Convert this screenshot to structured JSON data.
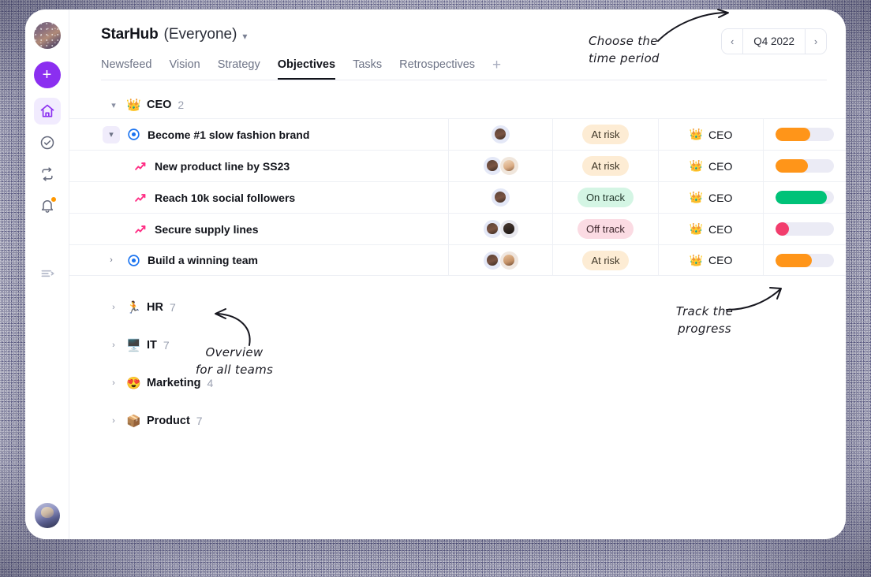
{
  "window": {
    "title_main": "StarHub",
    "title_sub": "(Everyone)",
    "title_caret": "chevron-down-icon"
  },
  "rail": {
    "workspace_avatar": "workspace-avatar",
    "add_label": "+",
    "items": [
      {
        "name": "home-icon",
        "active": true
      },
      {
        "name": "check-circle-icon",
        "active": false
      },
      {
        "name": "sync-icon",
        "active": false
      },
      {
        "name": "bell-icon",
        "active": false,
        "badge": true
      }
    ],
    "collapse_icon": "collapse-sidebar-icon",
    "user_avatar": "user-avatar"
  },
  "tabs": [
    {
      "label": "Newsfeed",
      "active": false
    },
    {
      "label": "Vision",
      "active": false
    },
    {
      "label": "Strategy",
      "active": false
    },
    {
      "label": "Objectives",
      "active": true
    },
    {
      "label": "Tasks",
      "active": false
    },
    {
      "label": "Retrospectives",
      "active": false
    }
  ],
  "tab_add": "+",
  "period": {
    "prev": "‹",
    "label": "Q4 2022",
    "next": "›"
  },
  "annotations": {
    "time_period": "Choose the\ntime period",
    "all_teams": "Overview\nfor all teams",
    "progress": "Track the\nprogress"
  },
  "group": {
    "chevron": "⌄",
    "emoji": "👑",
    "name": "CEO",
    "count": "2"
  },
  "rows": [
    {
      "label": "Become #1 slow fashion brand",
      "level": 1,
      "type": "objective",
      "chevron": "open",
      "owners": [
        "a1"
      ],
      "status": "At risk",
      "status_class": "at-risk",
      "team_emoji": "👑",
      "team": "CEO",
      "progress": 60,
      "progress_color": "#ff9519"
    },
    {
      "label": "New product line by SS23",
      "level": 2,
      "type": "key-result",
      "chevron": "none",
      "owners": [
        "a1",
        "a2"
      ],
      "status": "At risk",
      "status_class": "at-risk",
      "team_emoji": "👑",
      "team": "CEO",
      "progress": 55,
      "progress_color": "#ff9519"
    },
    {
      "label": "Reach 10k social followers",
      "level": 2,
      "type": "key-result",
      "chevron": "none",
      "owners": [
        "a1"
      ],
      "status": "On track",
      "status_class": "on-track",
      "team_emoji": "👑",
      "team": "CEO",
      "progress": 88,
      "progress_color": "#00c278"
    },
    {
      "label": "Secure supply lines",
      "level": 2,
      "type": "key-result",
      "chevron": "none",
      "owners": [
        "a1",
        "a3"
      ],
      "status": "Off track",
      "status_class": "off-track",
      "team_emoji": "👑",
      "team": "CEO",
      "progress": 22,
      "progress_color": "#f23d6d"
    },
    {
      "label": "Build a winning team",
      "level": 1,
      "type": "objective",
      "chevron": "closed",
      "owners": [
        "a1",
        "a4"
      ],
      "status": "At risk",
      "status_class": "at-risk",
      "team_emoji": "👑",
      "team": "CEO",
      "progress": 62,
      "progress_color": "#ff9519"
    }
  ],
  "teams": [
    {
      "chevron": "›",
      "emoji": "🏃",
      "name": "HR",
      "count": "7"
    },
    {
      "chevron": "›",
      "emoji": "🖥️",
      "name": "IT",
      "count": "7"
    },
    {
      "chevron": "›",
      "emoji": "😍",
      "name": "Marketing",
      "count": "4"
    },
    {
      "chevron": "›",
      "emoji": "📦",
      "name": "Product",
      "count": "7"
    }
  ],
  "colors": {
    "accent_purple": "#8b2ff0",
    "objective_blue": "#1a73f0",
    "key_result_pink": "#ff2d84",
    "progress_orange": "#ff9519",
    "progress_green": "#00c278",
    "progress_pink": "#f23d6d"
  }
}
